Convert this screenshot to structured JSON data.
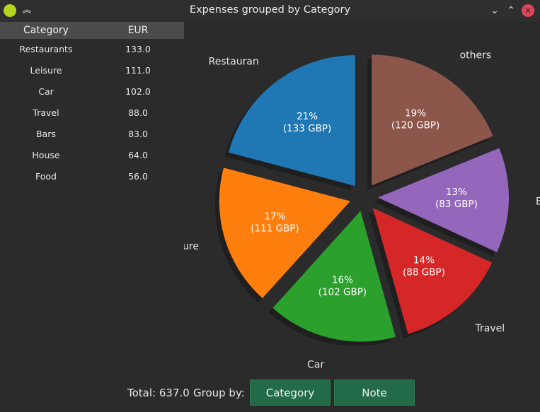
{
  "window": {
    "title": "Expenses grouped by Category"
  },
  "table": {
    "headers": [
      "Category",
      "EUR"
    ],
    "rows": [
      {
        "category": "Restaurants",
        "eur": "133.0"
      },
      {
        "category": "Leisure",
        "eur": "111.0"
      },
      {
        "category": "Car",
        "eur": "102.0"
      },
      {
        "category": "Travel",
        "eur": "88.0"
      },
      {
        "category": "Bars",
        "eur": "83.0"
      },
      {
        "category": "House",
        "eur": "64.0"
      },
      {
        "category": "Food",
        "eur": "56.0"
      }
    ]
  },
  "chart_data": {
    "type": "pie",
    "labels": [
      "Restauran",
      "Leisure",
      "Car",
      "Travel",
      "Bars",
      "others"
    ],
    "values": [
      133,
      111,
      102,
      88,
      83,
      120
    ],
    "percent_labels": [
      "21%",
      "17%",
      "16%",
      "14%",
      "13%",
      "19%"
    ],
    "value_labels": [
      "(133 GBP)",
      "(111 GBP)",
      "(102 GBP)",
      "(88 GBP)",
      "(83 GBP)",
      "(120 GBP)"
    ],
    "colors": [
      "#1f77b4",
      "#ff7f0e",
      "#2ca02c",
      "#d62728",
      "#9467bd",
      "#8c564b"
    ],
    "start_angle_deg": 90,
    "direction": "counterclockwise",
    "exploded": true,
    "shadow": true
  },
  "footer": {
    "total_label": "Total: 637.0",
    "group_by_label": "Group by:",
    "buttons": [
      "Category",
      "Note"
    ]
  }
}
